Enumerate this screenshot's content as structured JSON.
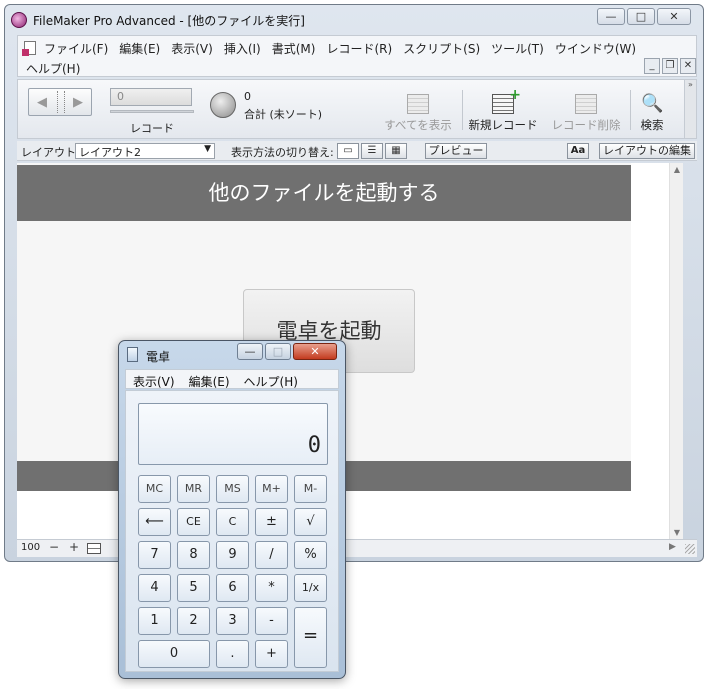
{
  "fm": {
    "title": "FileMaker Pro Advanced - [他のファイルを実行]",
    "window_controls": {
      "minimize": "—",
      "maximize": "□",
      "close": "✕"
    },
    "menu_row1": [
      "ファイル(F)",
      "編集(E)",
      "表示(V)",
      "挿入(I)",
      "書式(M)",
      "レコード(R)",
      "スクリプト(S)",
      "ツール(T)",
      "ウインドウ(W)"
    ],
    "menu_row2": [
      "ヘルプ(H)"
    ],
    "mdi_controls": {
      "minimize": "_",
      "restore": "❐",
      "close": "✕"
    },
    "toolbar": {
      "book_prev": "◀",
      "book_next": "▶",
      "record_value": "0",
      "record_label": "レコード",
      "found_count": "0",
      "total_label": "合計 (未ソート)",
      "show_all": "すべてを表示",
      "new_record": "新規レコード",
      "delete_record": "レコード削除",
      "find": "検索",
      "find_icon": "🔍",
      "scroll_glyph": "»"
    },
    "layout_bar": {
      "layout_label": "レイアウト:",
      "layout_value": "レイアウト2",
      "select_arrow": "▼",
      "view_switch_label": "表示方法の切り替え:",
      "view_form": "▭",
      "view_list": "☰",
      "view_table": "▦",
      "preview": "プレビュー",
      "text_format": "Aa",
      "edit_layout": "レイアウトの編集"
    },
    "content": {
      "header_title": "他のファイルを起動する",
      "launch_button": "電卓を起動"
    },
    "scroll": {
      "up": "▲",
      "down": "▼",
      "right": "▶"
    },
    "status_bar": {
      "zoom_level": "100",
      "zoom_out": "−",
      "zoom_in": "+"
    }
  },
  "calc": {
    "title": "電卓",
    "controls": {
      "minimize": "—",
      "maximize": "□",
      "close": "✕"
    },
    "menu": [
      "表示(V)",
      "編集(E)",
      "ヘルプ(H)"
    ],
    "display_value": "0",
    "keys": {
      "mc": "MC",
      "mr": "MR",
      "ms": "MS",
      "mplus": "M+",
      "mminus": "M-",
      "back": "⟵",
      "ce": "CE",
      "c": "C",
      "plusminus": "±",
      "sqrt": "√",
      "k7": "7",
      "k8": "8",
      "k9": "9",
      "div": "/",
      "pct": "%",
      "k4": "4",
      "k5": "5",
      "k6": "6",
      "mul": "*",
      "recip": "1/x",
      "k1": "1",
      "k2": "2",
      "k3": "3",
      "sub": "-",
      "eq": "=",
      "k0": "0",
      "dot": ".",
      "add": "+"
    }
  }
}
